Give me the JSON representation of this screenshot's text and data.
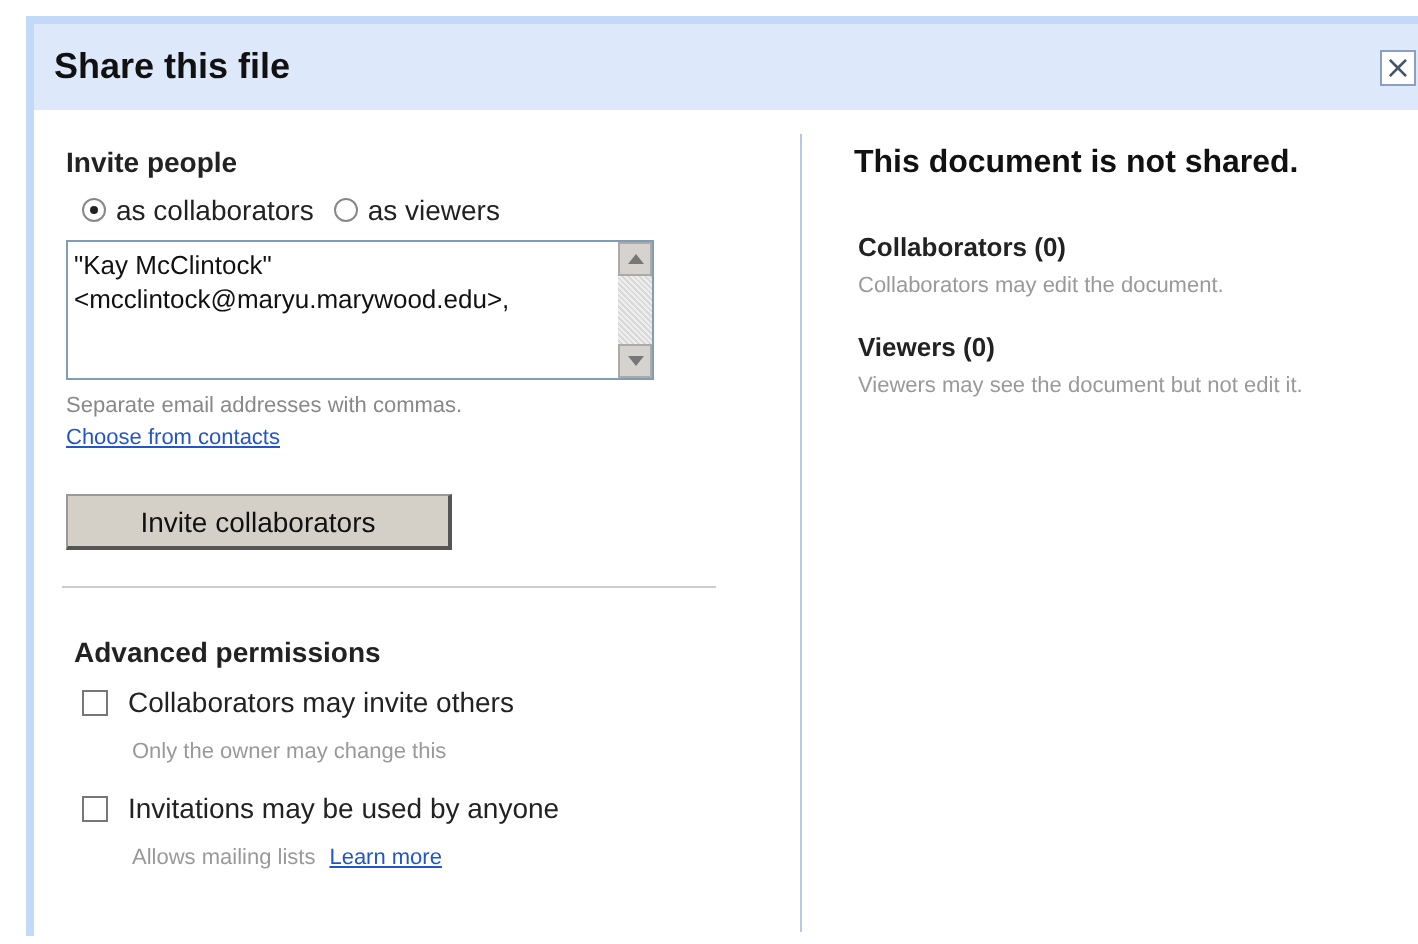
{
  "dialog": {
    "title": "Share this file",
    "close": "×"
  },
  "invite": {
    "heading": "Invite people",
    "roles": [
      {
        "label": "as collaborators",
        "selected": true
      },
      {
        "label": "as viewers",
        "selected": false
      }
    ],
    "emails": "\"Kay McClintock\"\n<mcclintock@maryu.marywood.edu>,",
    "hint": "Separate email addresses with commas.",
    "contacts_link": "Choose from contacts",
    "button": "Invite collaborators"
  },
  "advanced": {
    "heading": "Advanced permissions",
    "options": [
      {
        "label": "Collaborators may invite others",
        "checked": false,
        "note": "Only the owner may change this"
      },
      {
        "label": "Invitations may be used by anyone",
        "checked": false,
        "note": "Allows mailing lists",
        "link": "Learn more"
      }
    ]
  },
  "status": {
    "heading": "This document is not shared.",
    "groups": [
      {
        "title": "Collaborators (0)",
        "note": "Collaborators may edit the document."
      },
      {
        "title": "Viewers (0)",
        "note": "Viewers may see the document but not edit it."
      }
    ]
  }
}
